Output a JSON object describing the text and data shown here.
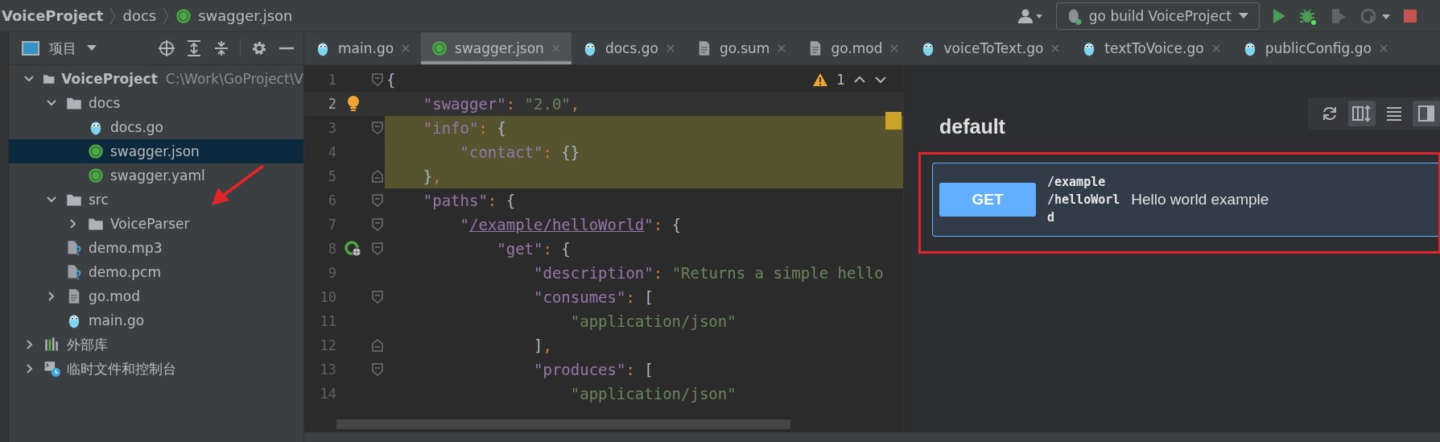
{
  "breadcrumb": [
    {
      "label": "VoiceProject",
      "bold": true,
      "kind": "project"
    },
    {
      "label": "docs",
      "bold": false,
      "kind": "folder"
    },
    {
      "label": "swagger.json",
      "bold": false,
      "kind": "swagger"
    }
  ],
  "run_config": {
    "label": "go build VoiceProject"
  },
  "project_panel": {
    "title": "项目"
  },
  "tree": [
    {
      "label": "VoiceProject",
      "detail": "C:\\Work\\GoProject\\V",
      "bold": true,
      "kind": "folder",
      "expanded": true,
      "selected": false,
      "children": [
        {
          "label": "docs",
          "bold": false,
          "kind": "folder",
          "expanded": true,
          "selected": false,
          "children": [
            {
              "label": "docs.go",
              "bold": false,
              "kind": "gopher",
              "selected": false
            },
            {
              "label": "swagger.json",
              "bold": false,
              "kind": "swagger",
              "selected": true
            },
            {
              "label": "swagger.yaml",
              "bold": false,
              "kind": "swagger",
              "selected": false
            }
          ]
        },
        {
          "label": "src",
          "bold": false,
          "kind": "folder",
          "expanded": true,
          "selected": false,
          "children": [
            {
              "label": "VoiceParser",
              "bold": false,
              "kind": "folder",
              "expanded": false,
              "selected": false
            }
          ]
        },
        {
          "label": "demo.mp3",
          "bold": false,
          "kind": "unknown",
          "selected": false
        },
        {
          "label": "demo.pcm",
          "bold": false,
          "kind": "unknown",
          "selected": false
        },
        {
          "label": "go.mod",
          "bold": false,
          "kind": "file",
          "expanded": false,
          "selected": false
        },
        {
          "label": "main.go",
          "bold": false,
          "kind": "gopher",
          "selected": false
        }
      ]
    },
    {
      "label": "外部库",
      "bold": false,
      "kind": "library",
      "expanded": false,
      "selected": false
    },
    {
      "label": "临时文件和控制台",
      "bold": false,
      "kind": "scratch",
      "expanded": false,
      "selected": false
    }
  ],
  "tabs": [
    {
      "label": "main.go",
      "kind": "gopher",
      "selected": false
    },
    {
      "label": "swagger.json",
      "kind": "swagger",
      "selected": true
    },
    {
      "label": "docs.go",
      "kind": "gopher",
      "selected": false
    },
    {
      "label": "go.sum",
      "kind": "file",
      "selected": false
    },
    {
      "label": "go.mod",
      "kind": "file",
      "selected": false
    },
    {
      "label": "voiceToText.go",
      "kind": "gopher",
      "selected": false
    },
    {
      "label": "textToVoice.go",
      "kind": "gopher",
      "selected": false
    },
    {
      "label": "publicConfig.go",
      "kind": "gopher",
      "selected": false
    }
  ],
  "editor": {
    "warning_count": "1",
    "lines": [
      {
        "number": "1",
        "current": false,
        "highlighted": false,
        "fold_start": true,
        "fold_end": false,
        "bulb": false,
        "endpoint": false,
        "segments": [
          {
            "text": "{",
            "kind": "brace"
          }
        ]
      },
      {
        "number": "2",
        "current": true,
        "highlighted": false,
        "fold_start": false,
        "fold_end": false,
        "bulb": true,
        "endpoint": false,
        "segments": [
          {
            "text": "    \"swagger\"",
            "kind": "key"
          },
          {
            "text": ": ",
            "kind": "punct"
          },
          {
            "text": "\"2.0\"",
            "kind": "string"
          },
          {
            "text": ",",
            "kind": "punct"
          }
        ]
      },
      {
        "number": "3",
        "current": false,
        "highlighted": true,
        "fold_start": true,
        "fold_end": false,
        "bulb": false,
        "endpoint": false,
        "segments": [
          {
            "text": "    \"info\"",
            "kind": "key"
          },
          {
            "text": ": ",
            "kind": "punct"
          },
          {
            "text": "{",
            "kind": "brace"
          }
        ]
      },
      {
        "number": "4",
        "current": false,
        "highlighted": true,
        "fold_start": false,
        "fold_end": false,
        "bulb": false,
        "endpoint": false,
        "segments": [
          {
            "text": "        \"contact\"",
            "kind": "key"
          },
          {
            "text": ": ",
            "kind": "punct"
          },
          {
            "text": "{}",
            "kind": "brace"
          }
        ]
      },
      {
        "number": "5",
        "current": false,
        "highlighted": true,
        "fold_start": false,
        "fold_end": true,
        "bulb": false,
        "endpoint": false,
        "segments": [
          {
            "text": "    }",
            "kind": "brace"
          },
          {
            "text": ",",
            "kind": "punct"
          }
        ]
      },
      {
        "number": "6",
        "current": false,
        "highlighted": false,
        "fold_start": true,
        "fold_end": false,
        "bulb": false,
        "endpoint": false,
        "segments": [
          {
            "text": "    \"paths\"",
            "kind": "key"
          },
          {
            "text": ": ",
            "kind": "punct"
          },
          {
            "text": "{",
            "kind": "brace"
          }
        ]
      },
      {
        "number": "7",
        "current": false,
        "highlighted": false,
        "fold_start": true,
        "fold_end": false,
        "bulb": false,
        "endpoint": false,
        "segments": [
          {
            "text": "        \"",
            "kind": "key"
          },
          {
            "text": "/example/helloWorld",
            "kind": "link"
          },
          {
            "text": "\"",
            "kind": "key"
          },
          {
            "text": ": ",
            "kind": "punct"
          },
          {
            "text": "{",
            "kind": "brace"
          }
        ]
      },
      {
        "number": "8",
        "current": false,
        "highlighted": false,
        "fold_start": true,
        "fold_end": false,
        "bulb": false,
        "endpoint": true,
        "segments": [
          {
            "text": "            \"get\"",
            "kind": "key"
          },
          {
            "text": ": ",
            "kind": "punct"
          },
          {
            "text": "{",
            "kind": "brace"
          }
        ]
      },
      {
        "number": "9",
        "current": false,
        "highlighted": false,
        "fold_start": false,
        "fold_end": false,
        "bulb": false,
        "endpoint": false,
        "segments": [
          {
            "text": "                \"description\"",
            "kind": "key"
          },
          {
            "text": ": ",
            "kind": "punct"
          },
          {
            "text": "\"Returns a simple hello",
            "kind": "string"
          }
        ]
      },
      {
        "number": "10",
        "current": false,
        "highlighted": false,
        "fold_start": true,
        "fold_end": false,
        "bulb": false,
        "endpoint": false,
        "segments": [
          {
            "text": "                \"consumes\"",
            "kind": "key"
          },
          {
            "text": ": ",
            "kind": "punct"
          },
          {
            "text": "[",
            "kind": "brace"
          }
        ]
      },
      {
        "number": "11",
        "current": false,
        "highlighted": false,
        "fold_start": false,
        "fold_end": false,
        "bulb": false,
        "endpoint": false,
        "segments": [
          {
            "text": "                    \"application/json\"",
            "kind": "string"
          }
        ]
      },
      {
        "number": "12",
        "current": false,
        "highlighted": false,
        "fold_start": false,
        "fold_end": true,
        "bulb": false,
        "endpoint": false,
        "segments": [
          {
            "text": "                ]",
            "kind": "brace"
          },
          {
            "text": ",",
            "kind": "punct"
          }
        ]
      },
      {
        "number": "13",
        "current": false,
        "highlighted": false,
        "fold_start": true,
        "fold_end": false,
        "bulb": false,
        "endpoint": false,
        "segments": [
          {
            "text": "                \"produces\"",
            "kind": "key"
          },
          {
            "text": ": ",
            "kind": "punct"
          },
          {
            "text": "[",
            "kind": "brace"
          }
        ]
      },
      {
        "number": "14",
        "current": false,
        "highlighted": false,
        "fold_start": false,
        "fold_end": false,
        "bulb": false,
        "endpoint": false,
        "segments": [
          {
            "text": "                    \"application/json\"",
            "kind": "string"
          }
        ]
      }
    ]
  },
  "swagger_panel": {
    "tag": "default",
    "toolbar": [
      {
        "kind": "refresh",
        "selected": false
      },
      {
        "kind": "columns",
        "selected": true
      },
      {
        "kind": "list",
        "selected": false
      },
      {
        "kind": "layout",
        "selected": true
      }
    ],
    "operations": [
      {
        "method": "GET",
        "path": "/example/helloWorld",
        "summary": "Hello world example"
      }
    ]
  }
}
